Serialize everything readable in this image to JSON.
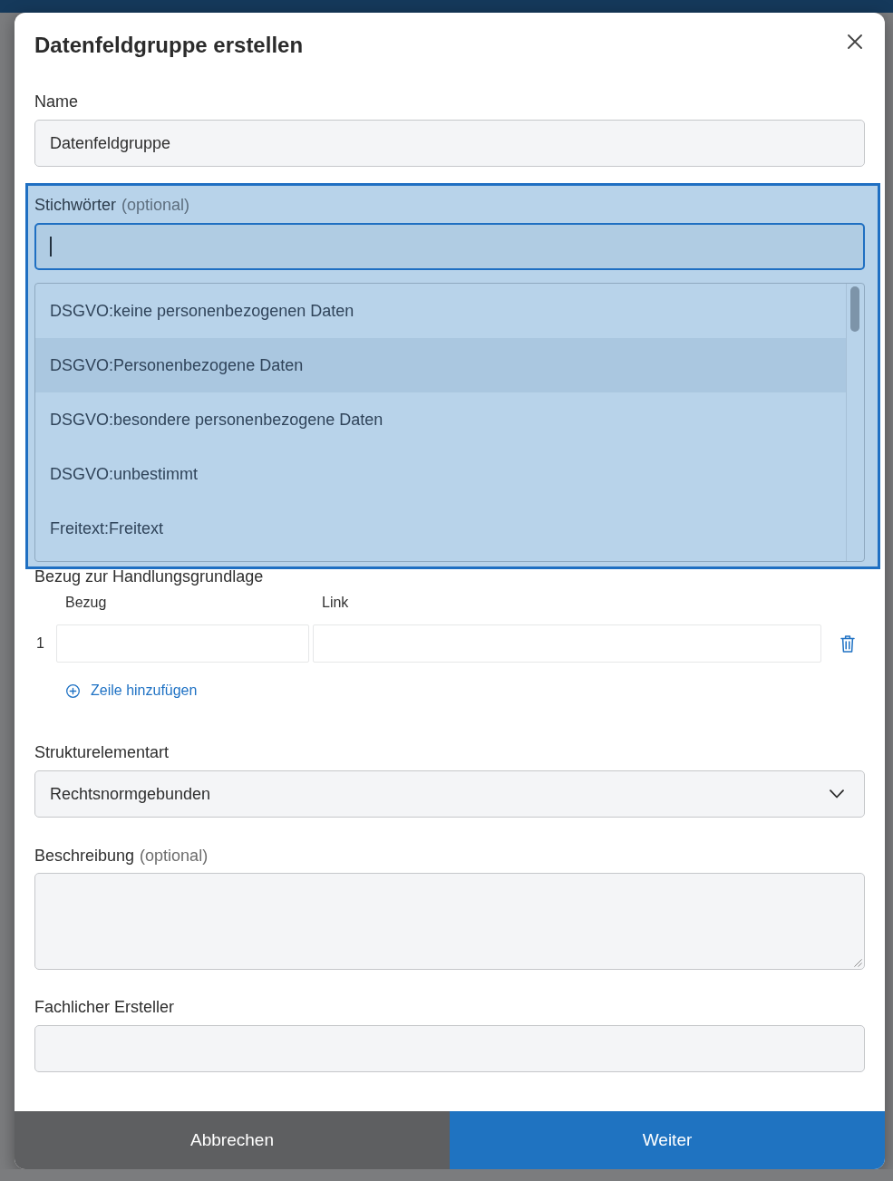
{
  "dialog": {
    "title": "Datenfeldgruppe erstellen"
  },
  "name_field": {
    "label": "Name",
    "value": "Datenfeldgruppe"
  },
  "keywords": {
    "label": "Stichwörter",
    "hint": "(optional)",
    "highlighted": true,
    "focused": true,
    "options": [
      {
        "label": "DSGVO:keine personenbezogenen Daten",
        "selected": false
      },
      {
        "label": "DSGVO:Personenbezogene Daten",
        "selected": true
      },
      {
        "label": "DSGVO:besondere personenbezogene Daten",
        "selected": false
      },
      {
        "label": "DSGVO:unbestimmt",
        "selected": false
      },
      {
        "label": "Freitext:Freitext",
        "selected": false
      }
    ]
  },
  "legal_basis": {
    "label": "Bezug zur Handlungsgrundlage",
    "columns": [
      "Bezug",
      "Link"
    ],
    "rows": [
      {
        "number": "1"
      }
    ],
    "add_row": "Zeile hinzufügen"
  },
  "structure_type": {
    "label": "Strukturelementart",
    "value": "Rechtsnormgebunden"
  },
  "description": {
    "label": "Beschreibung",
    "hint": "(optional)"
  },
  "creator": {
    "label": "Fachlicher Ersteller"
  },
  "footer": {
    "buttons": [
      {
        "label": "Abbrechen",
        "kind": "secondary"
      },
      {
        "label": "Weiter",
        "kind": "primary"
      }
    ]
  }
}
